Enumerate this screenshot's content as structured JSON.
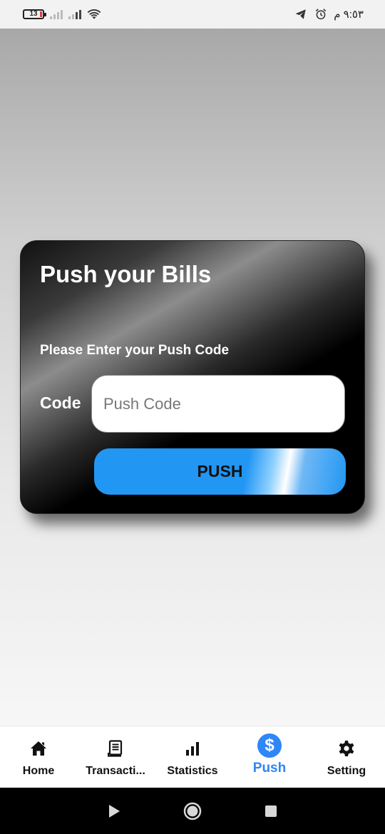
{
  "status_bar": {
    "battery_level": "13",
    "time": "٩:٥٣ م",
    "icons": [
      "battery-icon",
      "signal-icon",
      "signal-icon",
      "wifi-icon",
      "telegram-icon",
      "alarm-icon"
    ]
  },
  "card": {
    "title": "Push your Bills",
    "subtitle": "Please Enter your Push Code",
    "code_label": "Code",
    "code_input": {
      "value": "",
      "placeholder": "Push Code"
    },
    "push_button_label": "PUSH"
  },
  "bottom_nav": {
    "items": [
      {
        "label": "Home",
        "icon": "home-icon",
        "active": false
      },
      {
        "label": "Transacti...",
        "icon": "receipt-icon",
        "active": false
      },
      {
        "label": "Statistics",
        "icon": "bar-chart-icon",
        "active": false
      },
      {
        "label": "Push",
        "icon": "dollar-icon",
        "active": true
      },
      {
        "label": "Setting",
        "icon": "gear-icon",
        "active": false
      }
    ]
  },
  "system_nav": {
    "buttons": [
      "back-icon",
      "home-circle-icon",
      "recents-icon"
    ]
  },
  "colors": {
    "accent": "#2f86f6",
    "push_button": "#2196f3",
    "card_dark": "#000000"
  }
}
